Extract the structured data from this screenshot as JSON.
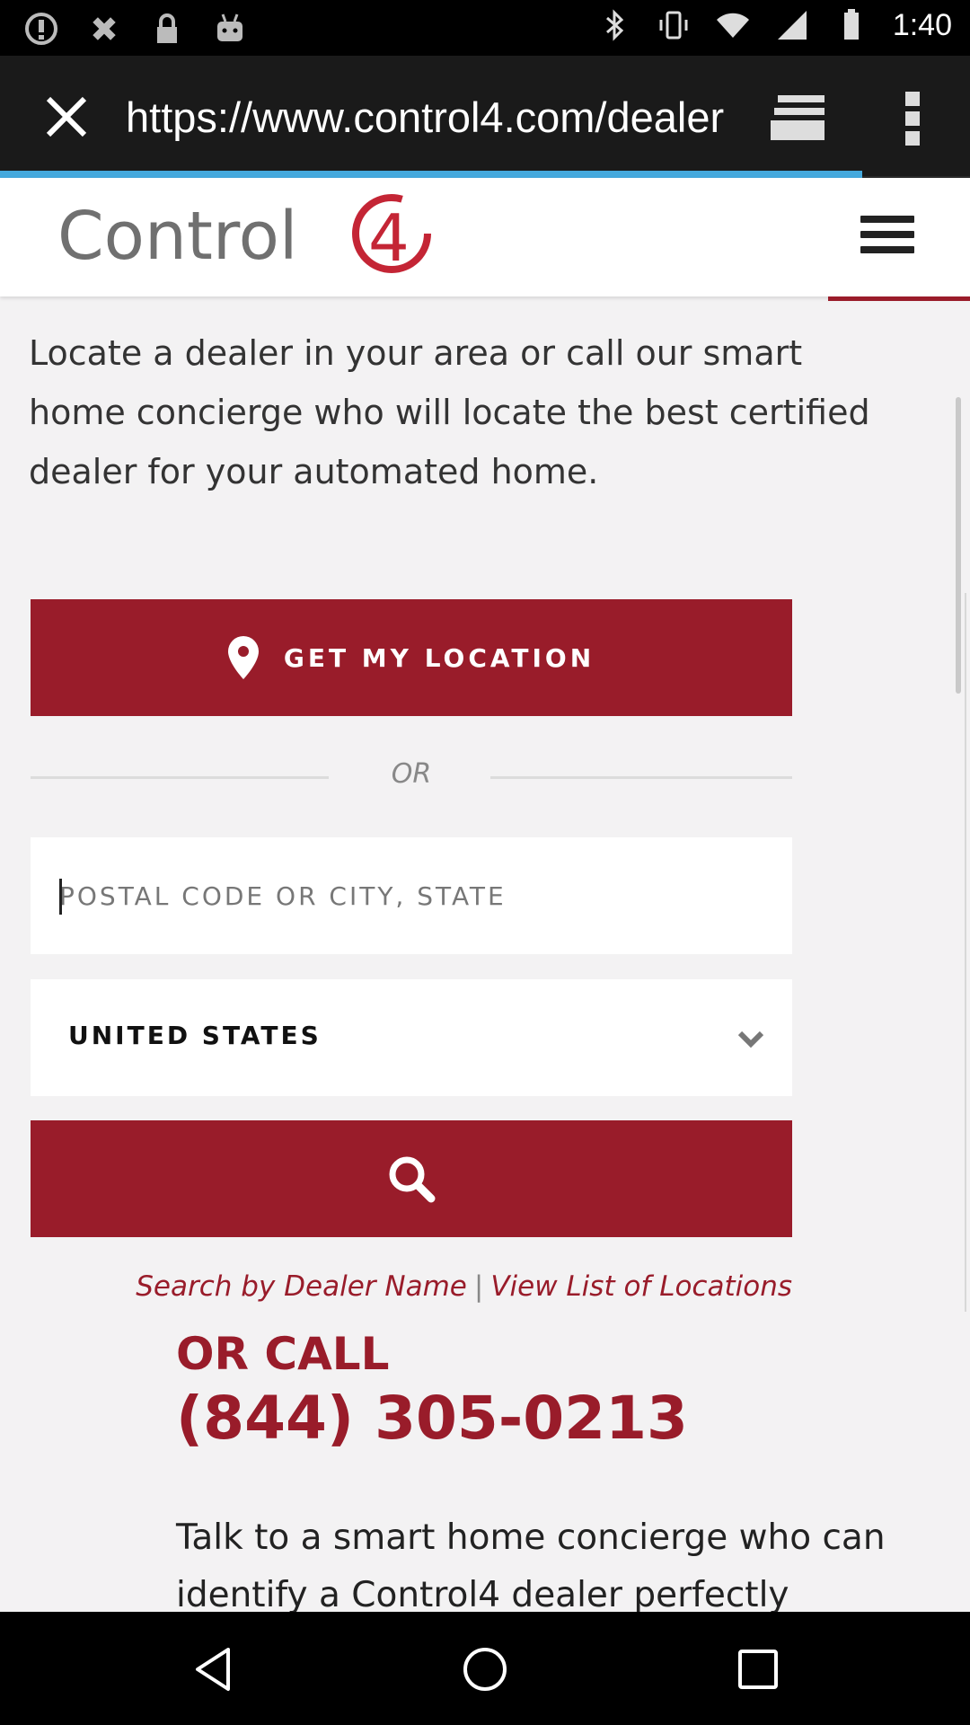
{
  "status_bar": {
    "time": "1:40",
    "left_icons": [
      "alert-icon",
      "satellite-icon",
      "lock-icon",
      "android-icon"
    ],
    "right_icons": [
      "bluetooth-icon",
      "vibrate-icon",
      "wifi-icon",
      "signal-icon",
      "battery-icon"
    ]
  },
  "browser": {
    "url": "https://www.control4.com/dealer",
    "close_icon": "close-icon",
    "tabs_icon": "tabs-icon",
    "menu_icon": "overflow-menu-icon",
    "progress_color": "#45a9dd"
  },
  "site": {
    "logo_text": "Control4",
    "menu_icon": "hamburger-icon",
    "brand_color": "#991c2a"
  },
  "main": {
    "intro": "Locate a dealer in your area or call our smart home concierge who will locate the best certified dealer for your automated home.",
    "get_location_label": "GET MY LOCATION",
    "or_label": "OR",
    "postal_placeholder": "POSTAL CODE OR CITY, STATE",
    "country_selected": "UNITED STATES",
    "search_by_name": "Search by Dealer Name",
    "separator": "|",
    "view_list": "View List of Locations",
    "or_call": "OR CALL",
    "phone": "(844) 305-0213",
    "talk": "Talk to a smart home concierge who can identify a Control4 dealer perfectly"
  },
  "nav_bar": {
    "back": "back-icon",
    "home": "home-icon",
    "recents": "recents-icon"
  }
}
